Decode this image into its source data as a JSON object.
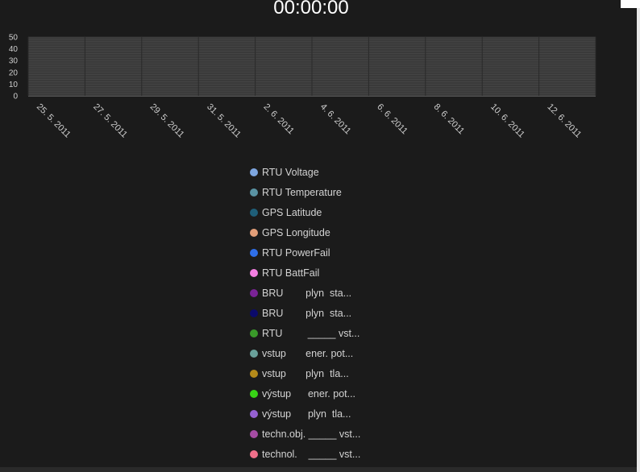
{
  "clock": "00:00:00",
  "chart_data": {
    "type": "line",
    "title": "",
    "xlabel": "",
    "ylabel": "",
    "ylim": [
      0,
      50
    ],
    "y_ticks": [
      "0",
      "10",
      "20",
      "30",
      "40",
      "50"
    ],
    "x_ticks": [
      "25. 5. 2011",
      "27. 5. 2011",
      "29. 5. 2011",
      "31. 5. 2011",
      "2. 6. 2011",
      "4. 6. 2011",
      "6. 6. 2011",
      "8. 6. 2011",
      "10. 6. 2011",
      "12. 6. 2011"
    ],
    "grid": true,
    "legend_position": "bottom",
    "series": [
      {
        "name": "RTU Voltage",
        "color": "#7ea6e0",
        "values": []
      },
      {
        "name": "RTU Temperature",
        "color": "#5a93a3",
        "values": []
      },
      {
        "name": "GPS Latitude",
        "color": "#1f5f79",
        "values": []
      },
      {
        "name": "GPS Longitude",
        "color": "#e29e78",
        "values": []
      },
      {
        "name": "RTU PowerFail",
        "color": "#2f6fe9",
        "values": []
      },
      {
        "name": "RTU BattFail",
        "color": "#f47fe2",
        "values": []
      },
      {
        "name": "BRU        plyn  sta...",
        "color": "#7a2396",
        "values": []
      },
      {
        "name": "BRU        plyn  sta...",
        "color": "#0b0a6b",
        "values": []
      },
      {
        "name": "RTU         _____ vst...",
        "color": "#3a9a2a",
        "values": []
      },
      {
        "name": "vstup       ener. pot...",
        "color": "#6aa19b",
        "values": []
      },
      {
        "name": "vstup       plyn  tla...",
        "color": "#b48a1a",
        "values": []
      },
      {
        "name": "výstup      ener. pot...",
        "color": "#38d316",
        "values": []
      },
      {
        "name": "výstup      plyn  tla...",
        "color": "#9561d2",
        "values": []
      },
      {
        "name": "techn.obj. _____ vst...",
        "color": "#a54ca3",
        "values": []
      },
      {
        "name": "technol.    _____ vst...",
        "color": "#f0708a",
        "values": []
      }
    ]
  }
}
